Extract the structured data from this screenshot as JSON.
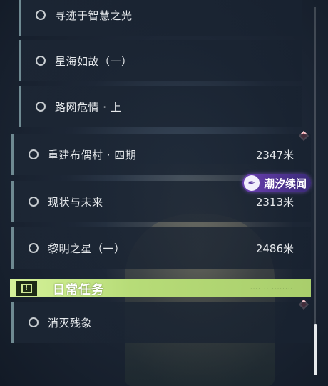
{
  "sub_quests": [
    {
      "name": "寻迹于智慧之光"
    },
    {
      "name": "星海如故（一）"
    },
    {
      "name": "路网危情 · 上"
    }
  ],
  "main_quests": [
    {
      "name": "重建布偶村 · 四期",
      "distance": "2347米"
    },
    {
      "name": "现状与未来",
      "distance": "2313米"
    },
    {
      "name": "黎明之星（一）",
      "distance": "2486米"
    }
  ],
  "tracking_tag": {
    "icon": "feather-quill-icon",
    "label": "潮汐续闻",
    "color": "#6a3fb0"
  },
  "daily_section": {
    "title": "日常任务",
    "header_color": "#c4e888",
    "quests": [
      {
        "name": "消灭残象"
      }
    ]
  },
  "marker_color": "#d94a5a"
}
